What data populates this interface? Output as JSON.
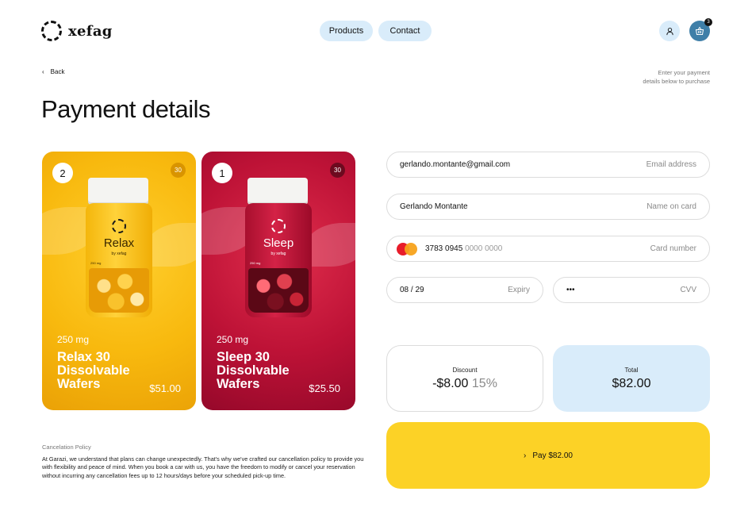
{
  "header": {
    "brand": "xefag",
    "nav": {
      "products": "Products",
      "contact": "Contact"
    },
    "cart_count": "3"
  },
  "back_label": "Back",
  "hint_lines": [
    "Enter your payment",
    "details below to purchase"
  ],
  "page_title": "Payment details",
  "products": [
    {
      "qty": "2",
      "count": "30",
      "bottle_name": "Relax",
      "bottle_sub": "by xefag",
      "bottle_mg": "250 mg",
      "mg": "250 mg",
      "name": "Relax 30 Dissolvable Wafers",
      "price": "$51.00",
      "color": "#f8b90e"
    },
    {
      "qty": "1",
      "count": "30",
      "bottle_name": "Sleep",
      "bottle_sub": "by xefag",
      "bottle_mg": "250 mg",
      "mg": "250 mg",
      "name": "Sleep 30 Dissolvable Wafers",
      "price": "$25.50",
      "color": "#bd1236"
    }
  ],
  "form": {
    "email": {
      "value": "gerlando.montante@gmail.com",
      "label": "Email address"
    },
    "name": {
      "value": "Gerlando Montante",
      "label": "Name on card"
    },
    "card": {
      "value_shown": "3783 0945",
      "value_masked": "0000 0000",
      "label": "Card number"
    },
    "expiry": {
      "value": "08 / 29",
      "label": "Expiry"
    },
    "cvv": {
      "value": "•••",
      "label": "CVV"
    }
  },
  "summary": {
    "discount_label": "Discount",
    "discount_value": "-$8.00",
    "discount_percent": "15%",
    "total_label": "Total",
    "total_value": "$82.00"
  },
  "pay_label": "Pay $82.00",
  "policy": {
    "title": "Cancelation Policy",
    "text": "At Garazi, we understand that plans can change unexpectedly. That's why we've crafted our cancellation policy to provide you with flexibility and peace of mind. When you book a car with us, you have the freedom to modify or cancel your reservation without incurring any cancellation fees up to 12 hours/days before your scheduled pick-up time."
  },
  "colors": {
    "accent_yellow": "#fcd226",
    "accent_blue": "#d9ecfa",
    "cart_blue": "#3f7fa8"
  }
}
